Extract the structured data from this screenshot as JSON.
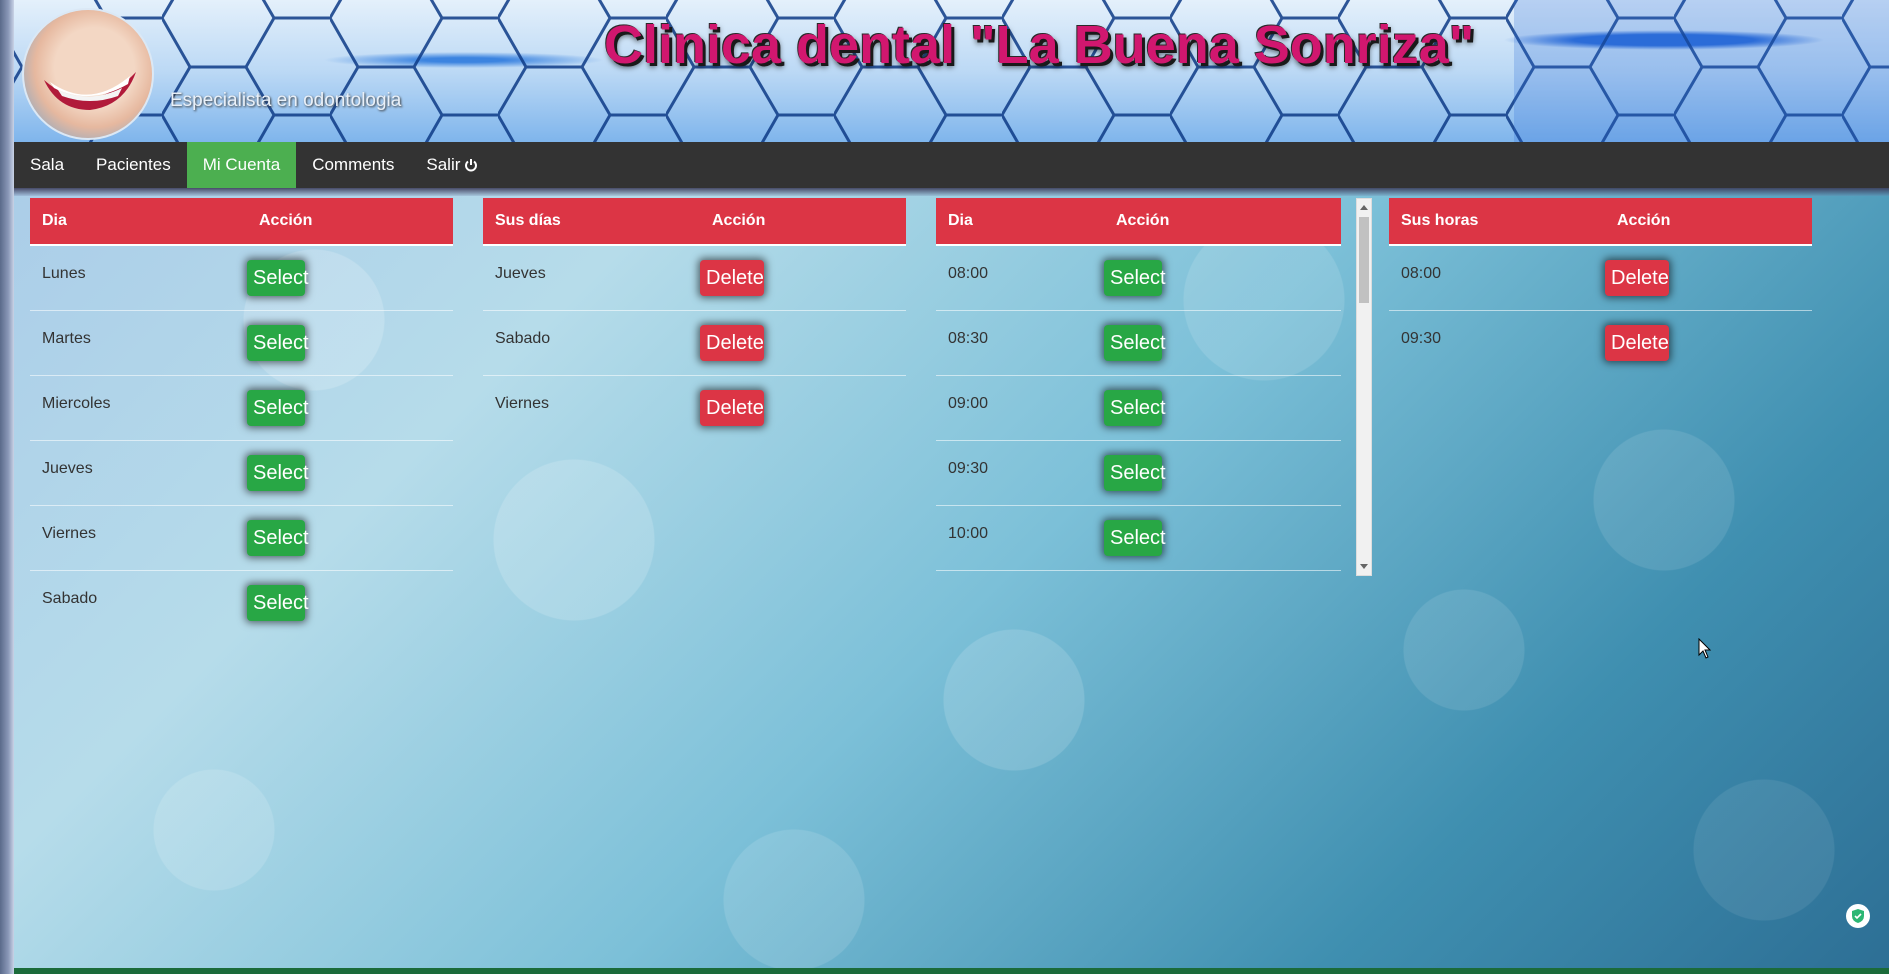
{
  "header": {
    "title": "Clinica dental \"La Buena Sonriza\"",
    "subtitle": "Especialista en odontologia"
  },
  "nav": {
    "items": [
      {
        "label": "Sala"
      },
      {
        "label": "Pacientes"
      },
      {
        "label": "Mi Cuenta",
        "active": true
      },
      {
        "label": "Comments"
      },
      {
        "label": "Salir"
      }
    ]
  },
  "tables": {
    "dias": {
      "headers": [
        "Dia",
        "Acción"
      ],
      "rows": [
        {
          "text": "Lunes",
          "action": "Select"
        },
        {
          "text": "Martes",
          "action": "Select"
        },
        {
          "text": "Miercoles",
          "action": "Select"
        },
        {
          "text": "Jueves",
          "action": "Select"
        },
        {
          "text": "Viernes",
          "action": "Select"
        },
        {
          "text": "Sabado",
          "action": "Select"
        }
      ]
    },
    "sus_dias": {
      "headers": [
        "Sus días",
        "Acción"
      ],
      "rows": [
        {
          "text": "Jueves",
          "action": "Delete"
        },
        {
          "text": "Sabado",
          "action": "Delete"
        },
        {
          "text": "Viernes",
          "action": "Delete"
        }
      ]
    },
    "horas": {
      "headers": [
        "Dia",
        "Acción"
      ],
      "rows": [
        {
          "text": "08:00",
          "action": "Select"
        },
        {
          "text": "08:30",
          "action": "Select"
        },
        {
          "text": "09:00",
          "action": "Select"
        },
        {
          "text": "09:30",
          "action": "Select"
        },
        {
          "text": "10:00",
          "action": "Select"
        }
      ]
    },
    "sus_horas": {
      "headers": [
        "Sus horas",
        "Acción"
      ],
      "rows": [
        {
          "text": "08:00",
          "action": "Delete"
        },
        {
          "text": "09:30",
          "action": "Delete"
        }
      ]
    }
  },
  "colors": {
    "header_red": "#dc3545",
    "select_green": "#28a745",
    "delete_red": "#dc3545",
    "nav_bg": "#333333",
    "nav_active": "#4caf50",
    "title_pink": "#d1176f"
  },
  "icons": {
    "power": "power-icon",
    "shield": "shield-check-icon",
    "cursor": "mouse-cursor-icon"
  }
}
